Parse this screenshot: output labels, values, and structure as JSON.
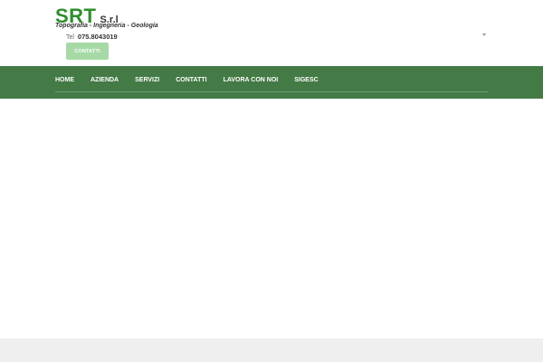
{
  "logo": {
    "name": "SRT",
    "suffix": "S.r.l",
    "tagline": "Topografia - Ingegneria - Geologia"
  },
  "contact": {
    "phone_label": "Tel",
    "phone_number": "075.8043019",
    "button_label": "CONTATTI"
  },
  "nav": {
    "items": [
      "HOME",
      "AZIENDA",
      "SERVIZI",
      "CONTATTI",
      "LAVORA CON NOI",
      "SIGESC"
    ]
  },
  "colors": {
    "brand_green": "#2e8f2e",
    "nav_background": "#437a45",
    "button_background": "#a6d9a6",
    "footer_band": "#efefef"
  },
  "icons": {
    "language_selector": "chevron-down-icon"
  }
}
